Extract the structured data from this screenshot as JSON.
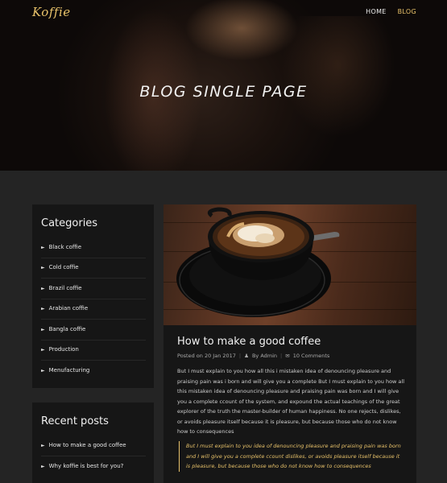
{
  "header": {
    "logo": "Koffie",
    "nav": [
      {
        "label": "HOME",
        "active": false
      },
      {
        "label": "BLOG",
        "active": true
      }
    ],
    "hero_title": "BLOG SINGLE PAGE"
  },
  "sidebar": {
    "categories": {
      "title": "Categories",
      "items": [
        "Black coffie",
        "Cold coffie",
        "Brazil coffie",
        "Arabian coffie",
        "Bangla coffie",
        "Production",
        "Menufacturing"
      ]
    },
    "recent": {
      "title": "Recent posts",
      "items": [
        "How to make a good coffee",
        "Why koffie is best for you?"
      ]
    }
  },
  "post": {
    "title": "How to make a good coffee",
    "date": "Posted on 20 Jan 2017",
    "author": "By Admin",
    "comments": "10 Comments",
    "body": "But I must explain to you how all this i mistaken idea of denouncing pleasure and praising pain was i born and will give you a complete But I must explain to you how all this mistaken idea of denouncing pleasure and praising pain was born and I will give you a complete ccount of the system, and expound the actual teachings of the great explorer of the truth the master-builder of human happiness. No one rejects, dislikes, or avoids pleasure itself because it is pleasure, but because those who do not know how to consequences",
    "quote": "But I must explain to you idea of denouncing pleasure and praising pain was born and I will give you a complete ccount dislikes, or avoids pleasure itself because it is pleasure, but because those who do not know how to consequences"
  },
  "colors": {
    "accent": "#e8c26a",
    "panel": "#161616",
    "background": "#242424"
  }
}
